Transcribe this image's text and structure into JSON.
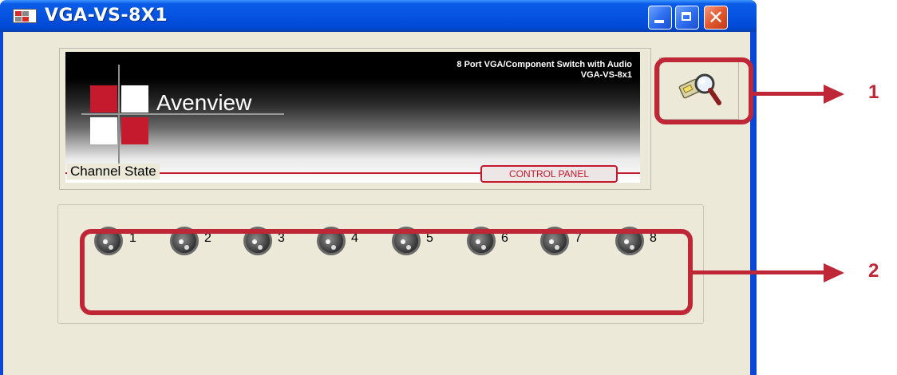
{
  "window": {
    "title": "VGA-VS-8X1",
    "close_glyph": "✕"
  },
  "banner": {
    "brand": "Avenview",
    "tagline_line1": "8 Port VGA/Component Switch with Audio",
    "tagline_line2": "VGA-VS-8x1",
    "control_panel": "CONTROL PANEL"
  },
  "toolbar": {
    "search_icon": "search-icon"
  },
  "channel_state": {
    "label": "Channel State",
    "channels": [
      "1",
      "2",
      "3",
      "4",
      "5",
      "6",
      "7",
      "8"
    ]
  },
  "annotations": {
    "callout_1": "1",
    "callout_2": "2"
  },
  "colors": {
    "title_bar": "#0553e0",
    "brand_red": "#c5192e",
    "annotation_red": "#bf2736",
    "client_bg": "#ece9d8"
  }
}
